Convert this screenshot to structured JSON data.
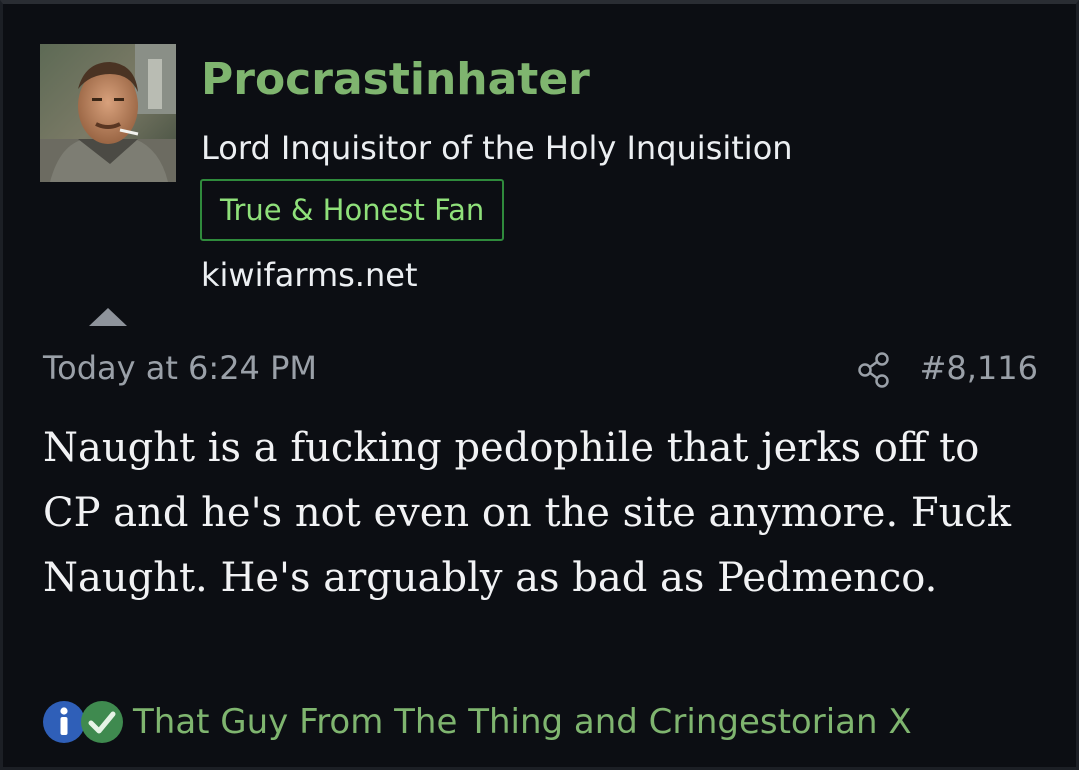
{
  "post": {
    "author": {
      "username": "Procrastinhater",
      "title": "Lord Inquisitor of the Holy Inquisition",
      "banner": "True & Honest Fan",
      "site": "kiwifarms.net",
      "avatar_icon": "avatar-photo"
    },
    "date": "Today at 6:24 PM",
    "number": "#8,116",
    "share_icon": "share-icon",
    "body": "Naught is a fucking pedophile that jerks off to CP and he's not even on the site anymore. Fuck Naught. He's arguably as bad as Pedmenco.",
    "reactions": {
      "icons": [
        "informative-icon",
        "agree-icon"
      ],
      "users_text": "That Guy From The Thing and Cringestorian X"
    }
  },
  "colors": {
    "background": "#0c0e13",
    "username": "#7fb56f",
    "banner_border": "#2f8a3c",
    "banner_text": "#8fe07a",
    "muted": "#9aa0a8",
    "body_text": "#f1f2f4"
  }
}
